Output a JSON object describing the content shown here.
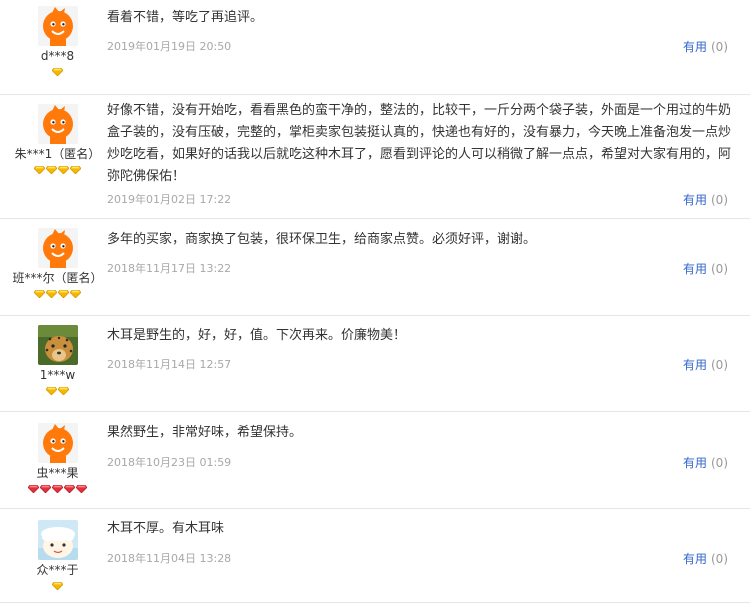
{
  "reviews": [
    {
      "user": "d***8",
      "gems": "gold",
      "gem_count": 1,
      "avatar": "mascot",
      "text": "看着不错，等吃了再追评。",
      "date": "2019年01月19日 20:50",
      "useful_label": "有用",
      "useful_count": "(0)"
    },
    {
      "user": "朱***1（匿名）",
      "gems": "gold",
      "gem_count": 4,
      "avatar": "mascot",
      "text": "好像不错，没有开始吃，看看黑色的蛮干净的，整法的，比较干，一斤分两个袋子装，外面是一个用过的牛奶盒子装的，没有压破，完整的，掌柜卖家包装挺认真的，快递也有好的，没有暴力，今天晚上准备泡发一点炒炒吃吃看，如果好的话我以后就吃这种木耳了，愿看到评论的人可以稍微了解一点点，希望对大家有用的，阿弥陀佛保佑！",
      "date": "2019年01月02日 17:22",
      "useful_label": "有用",
      "useful_count": "(0)"
    },
    {
      "user": "班***尔（匿名）",
      "gems": "gold",
      "gem_count": 4,
      "avatar": "mascot",
      "text": "多年的买家，商家换了包装，很环保卫生，给商家点赞。必须好评，谢谢。",
      "date": "2018年11月17日 13:22",
      "useful_label": "有用",
      "useful_count": "(0)"
    },
    {
      "user": "1***w",
      "gems": "gold",
      "gem_count": 2,
      "avatar": "leopard",
      "text": "木耳是野生的，好，好，值。下次再来。价廉物美！",
      "date": "2018年11月14日 12:57",
      "useful_label": "有用",
      "useful_count": "(0)"
    },
    {
      "user": "虫***果",
      "gems": "red",
      "gem_count": 5,
      "avatar": "mascot",
      "text": "果然野生，非常好味，希望保持。",
      "date": "2018年10月23日 01:59",
      "useful_label": "有用",
      "useful_count": "(0)"
    },
    {
      "user": "众***于",
      "gems": "gold",
      "gem_count": 1,
      "avatar": "cartoon",
      "text": "木耳不厚。有木耳味",
      "date": "2018年11月04日 13:28",
      "useful_label": "有用",
      "useful_count": "(0)"
    }
  ],
  "colors": {
    "link": "#3366cc",
    "date": "#a8a8a8",
    "gold_gem": "#f5b800",
    "red_gem": "#e0303a",
    "mascot": "#ff7a0a"
  }
}
